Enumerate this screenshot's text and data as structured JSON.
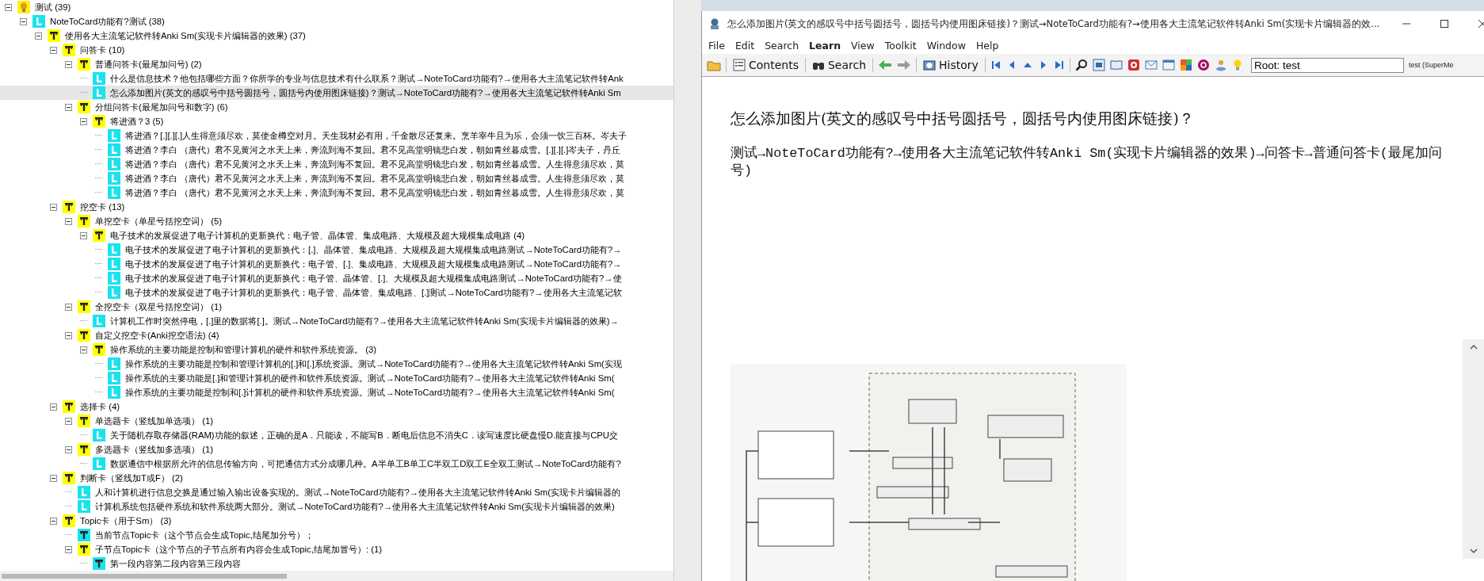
{
  "tree": [
    {
      "kind": "bulb",
      "label": "测试 (39)",
      "selected": false,
      "expanded": true,
      "children": [
        {
          "kind": "item",
          "label": "NoteToCard功能有?测试 (38)",
          "selected": false,
          "expanded": true,
          "children": [
            {
              "kind": "topic",
              "label": "使用各大主流笔记软件转Anki Sm(实现卡片编辑器的效果) (37)",
              "selected": false,
              "expanded": true,
              "children": [
                {
                  "kind": "topic",
                  "label": "问答卡 (10)",
                  "selected": false,
                  "expanded": true,
                  "children": [
                    {
                      "kind": "topic",
                      "label": "普通问答卡(最尾加问号) (2)",
                      "selected": false,
                      "expanded": true,
                      "children": [
                        {
                          "kind": "item",
                          "label": "什么是信息技术？他包括哪些方面？你所学的专业与信息技术有什么联系？测试→NoteToCard功能有?→使用各大主流笔记软件转Ank",
                          "selected": false
                        },
                        {
                          "kind": "item",
                          "label": "怎么添加图片(英文的感叹号中括号圆括号，圆括号内使用图床链接)？测试→NoteToCard功能有?→使用各大主流笔记软件转Anki Sm",
                          "selected": true
                        }
                      ]
                    },
                    {
                      "kind": "topic",
                      "label": "分组问答卡(最尾加问号和数字) (6)",
                      "selected": false,
                      "expanded": true,
                      "children": [
                        {
                          "kind": "topic",
                          "label": "将进酒？3 (5)",
                          "selected": false,
                          "expanded": true,
                          "children": [
                            {
                              "kind": "item",
                              "label": "将进酒？[.][.][.]人生得意须尽欢，莫使金樽空对月。天生我材必有用，千金散尽还复来。烹羊宰牛且为乐，会须一饮三百杯。岑夫子",
                              "selected": false
                            },
                            {
                              "kind": "item",
                              "label": "将进酒？李白 （唐代）君不见黄河之水天上来，奔流到海不复回。君不见高堂明镜悲白发，朝如青丝暮成雪。[.][.][.]岑夫子，丹丘",
                              "selected": false
                            },
                            {
                              "kind": "item",
                              "label": "将进酒？李白 （唐代）君不见黄河之水天上来，奔流到海不复回。君不见高堂明镜悲白发，朝如青丝暮成雪。人生得意须尽欢，莫",
                              "selected": false
                            },
                            {
                              "kind": "item",
                              "label": "将进酒？李白 （唐代）君不见黄河之水天上来，奔流到海不复回。君不见高堂明镜悲白发，朝如青丝暮成雪。人生得意须尽欢，莫",
                              "selected": false
                            },
                            {
                              "kind": "item",
                              "label": "将进酒？李白 （唐代）君不见黄河之水天上来，奔流到海不复回。君不见高堂明镜悲白发，朝如青丝暮成雪。人生得意须尽欢，莫",
                              "selected": false
                            }
                          ]
                        }
                      ]
                    }
                  ]
                },
                {
                  "kind": "topic",
                  "label": "挖空卡 (13)",
                  "selected": false,
                  "expanded": true,
                  "children": [
                    {
                      "kind": "topic",
                      "label": "单挖空卡（单星号括挖空词） (5)",
                      "selected": false,
                      "expanded": true,
                      "children": [
                        {
                          "kind": "topic",
                          "label": "电子技术的发展促进了电子计算机的更新换代：电子管、晶体管、集成电路、大规模及超大规模集成电路 (4)",
                          "selected": false,
                          "expanded": true,
                          "children": [
                            {
                              "kind": "item",
                              "label": "电子技术的发展促进了电子计算机的更新换代：[.]、晶体管、集成电路、大规模及超大规模集成电路测试→NoteToCard功能有?→",
                              "selected": false
                            },
                            {
                              "kind": "item",
                              "label": "电子技术的发展促进了电子计算机的更新换代：电子管、[.]、集成电路、大规模及超大规模集成电路测试→NoteToCard功能有?→",
                              "selected": false
                            },
                            {
                              "kind": "item",
                              "label": "电子技术的发展促进了电子计算机的更新换代：电子管、晶体管、[.]、大规模及超大规模集成电路测试→NoteToCard功能有?→使",
                              "selected": false
                            },
                            {
                              "kind": "item",
                              "label": "电子技术的发展促进了电子计算机的更新换代：电子管、晶体管、集成电路、[.]测试→NoteToCard功能有?→使用各大主流笔记软",
                              "selected": false
                            }
                          ]
                        }
                      ]
                    },
                    {
                      "kind": "topic",
                      "label": "全挖空卡（双星号括挖空词） (1)",
                      "selected": false,
                      "expanded": true,
                      "children": [
                        {
                          "kind": "item",
                          "label": "计算机工作时突然停电，[.]里的数据将[.]。测试→NoteToCard功能有?→使用各大主流笔记软件转Anki Sm(实现卡片编辑器的效果)→",
                          "selected": false
                        }
                      ]
                    },
                    {
                      "kind": "topic",
                      "label": "自定义挖空卡(Anki挖空语法) (4)",
                      "selected": false,
                      "expanded": true,
                      "children": [
                        {
                          "kind": "topic",
                          "label": "操作系统的主要功能是控制和管理计算机的硬件和软件系统资源。 (3)",
                          "selected": false,
                          "expanded": true,
                          "children": [
                            {
                              "kind": "item",
                              "label": "操作系统的主要功能是控制和管理计算机的[.]和[.]系统资源。测试→NoteToCard功能有?→使用各大主流笔记软件转Anki Sm(实现",
                              "selected": false
                            },
                            {
                              "kind": "item",
                              "label": "操作系统的主要功能是[.]和管理计算机的硬件和软件系统资源。测试→NoteToCard功能有?→使用各大主流笔记软件转Anki Sm(",
                              "selected": false
                            },
                            {
                              "kind": "item",
                              "label": "操作系统的主要功能是控制和[.]计算机的硬件和软件系统资源。测试→NoteToCard功能有?→使用各大主流笔记软件转Anki Sm(",
                              "selected": false
                            }
                          ]
                        }
                      ]
                    }
                  ]
                },
                {
                  "kind": "topic",
                  "label": "选择卡 (4)",
                  "selected": false,
                  "expanded": true,
                  "children": [
                    {
                      "kind": "topic",
                      "label": "单选题卡（竖线加单选项） (1)",
                      "selected": false,
                      "expanded": true,
                      "children": [
                        {
                          "kind": "item",
                          "label": "关于随机存取存储器(RAM)功能的叙述，正确的是A．只能读，不能写B．断电后信息不消失C．读写速度比硬盘慢D.能直接与CPU交",
                          "selected": false
                        }
                      ]
                    },
                    {
                      "kind": "topic",
                      "label": "多选题卡（竖线加多选项） (1)",
                      "selected": false,
                      "expanded": true,
                      "children": [
                        {
                          "kind": "item",
                          "label": "数据通信中根据所允许的信息传输方向，可把通信方式分成哪几种。A半单工B单工C半双工D双工E全双工测试→NoteToCard功能有?",
                          "selected": false
                        }
                      ]
                    }
                  ]
                },
                {
                  "kind": "topic",
                  "label": "判断卡（竖线加T或F） (2)",
                  "selected": false,
                  "expanded": true,
                  "children": [
                    {
                      "kind": "item",
                      "label": "人和计算机进行信息交换是通过输入输出设备实现的。测试→NoteToCard功能有?→使用各大主流笔记软件转Anki Sm(实现卡片编辑器的",
                      "selected": false
                    },
                    {
                      "kind": "item",
                      "label": "计算机系统包括硬件系统和软件系统两大部分。测试→NoteToCard功能有?→使用各大主流笔记软件转Anki Sm(实现卡片编辑器的效果)",
                      "selected": false
                    }
                  ]
                },
                {
                  "kind": "topic",
                  "label": "Topic卡（用于Sm） (3)",
                  "selected": false,
                  "expanded": true,
                  "children": [
                    {
                      "kind": "topic_leaf",
                      "label": "当前节点Topic卡（这个节点会生成Topic,结尾加分号）；",
                      "selected": false
                    },
                    {
                      "kind": "topic",
                      "label": "子节点Topic卡（这个节点的子节点所有内容会生成Topic,结尾加冒号）: (1)",
                      "selected": false,
                      "expanded": true,
                      "children": [
                        {
                          "kind": "topic_leaf",
                          "label": "第一段内容第二段内容第三段内容",
                          "selected": false
                        }
                      ]
                    }
                  ]
                }
              ]
            }
          ]
        }
      ]
    }
  ],
  "window": {
    "title": "怎么添加图片(英文的感叹号中括号圆括号，圆括号内使用图床链接)？测试→NoteToCard功能有?→使用各大主流笔记软件转Anki Sm(实现卡片编辑器的效..."
  },
  "menu": [
    {
      "label": "File",
      "bold": false
    },
    {
      "label": "Edit",
      "bold": false
    },
    {
      "label": "Search",
      "bold": false
    },
    {
      "label": "Learn",
      "bold": true
    },
    {
      "label": "View",
      "bold": false
    },
    {
      "label": "Toolkit",
      "bold": false
    },
    {
      "label": "Window",
      "bold": false
    },
    {
      "label": "Help",
      "bold": false
    }
  ],
  "toolbar": {
    "buttons": [
      {
        "label": "Contents"
      },
      {
        "label": "Search"
      },
      {
        "label": "History"
      }
    ],
    "field": {
      "value": "Root: test"
    },
    "status": "test (SuperMe"
  },
  "content": {
    "heading": "怎么添加图片(英文的感叹号中括号圆括号，圆括号内使用图床链接)？",
    "path": "测试→NoteToCard功能有?→使用各大主流笔记软件转Anki Sm(实现卡片编辑器的效果)→问答卡→普通问答卡(最尾加问号)"
  }
}
